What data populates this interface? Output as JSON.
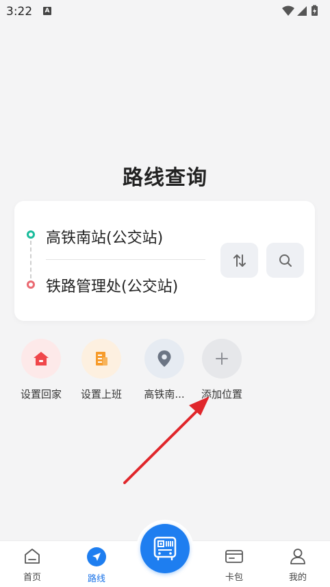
{
  "status_bar": {
    "time": "3:22",
    "notification": "A",
    "icons": [
      "wifi-icon",
      "signal-icon",
      "battery-icon"
    ]
  },
  "page": {
    "title": "路线查询"
  },
  "route": {
    "origin": "高铁南站(公交站)",
    "destination": "铁路管理处(公交站)",
    "swap_icon": "swap-vertical-icon",
    "search_icon": "search-icon"
  },
  "quick_locations": [
    {
      "label": "设置回家",
      "icon": "home-icon",
      "color": "#f0464a"
    },
    {
      "label": "设置上班",
      "icon": "building-icon",
      "color": "#f79b2a"
    },
    {
      "label": "高铁南...",
      "icon": "location-pin-icon",
      "color": "#6c7584"
    },
    {
      "label": "添加位置",
      "icon": "plus-icon",
      "color": "#8c8e94"
    }
  ],
  "bottom_nav": {
    "items": [
      {
        "label": "首页",
        "icon": "home-outline-icon",
        "active": false
      },
      {
        "label": "路线",
        "icon": "navigation-arrow-icon",
        "active": true
      },
      {
        "label": "卡包",
        "icon": "card-wallet-icon",
        "active": false
      },
      {
        "label": "我的",
        "icon": "user-icon",
        "active": false
      }
    ],
    "center_icon": "bus-qr-icon"
  },
  "colors": {
    "accent": "#1e7ef0",
    "start_dot": "#1abc9c",
    "end_dot": "#ea6a72",
    "annotation_arrow": "#e0262b"
  }
}
